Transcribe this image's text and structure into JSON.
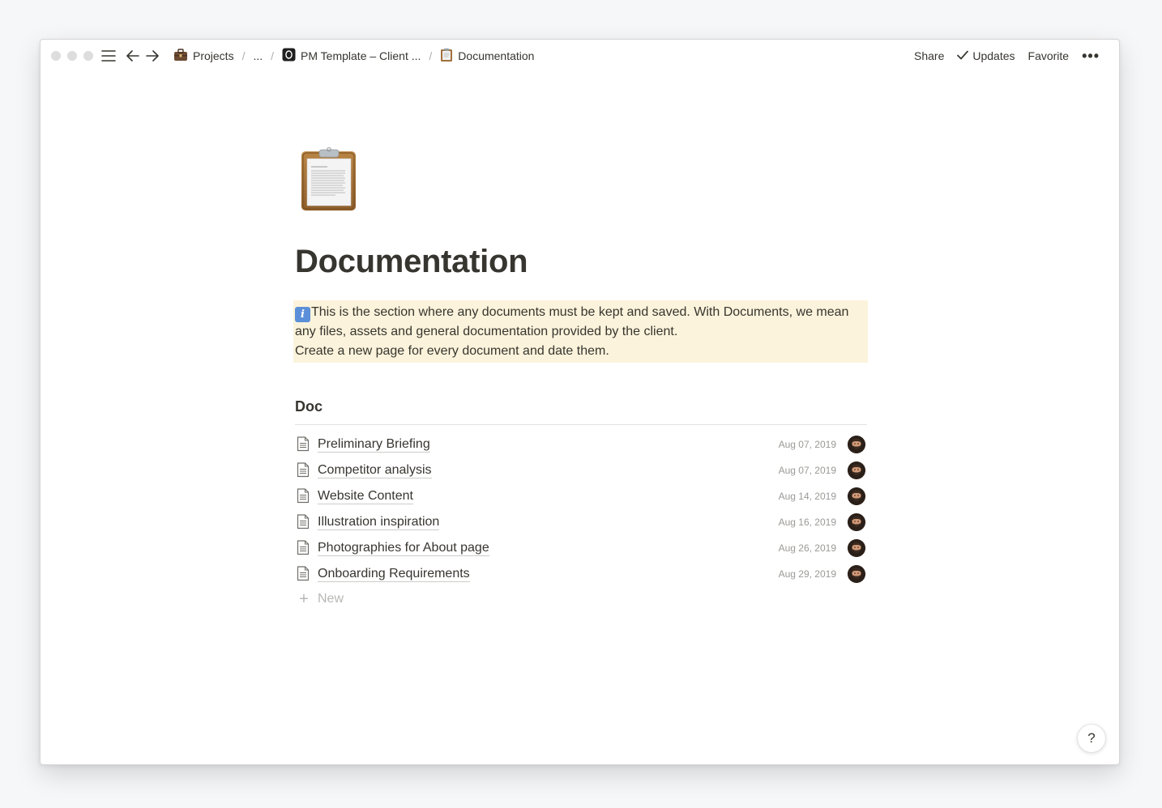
{
  "window": {
    "breadcrumbs": [
      {
        "label": "Projects",
        "icon": "briefcase-icon"
      },
      {
        "label": "..."
      },
      {
        "label": "PM Template – Client ...",
        "icon": "notion-logo-icon"
      },
      {
        "label": "Documentation",
        "icon": "clipboard-icon"
      }
    ],
    "separator": "/",
    "actions": {
      "share": "Share",
      "updates": "Updates",
      "favorite": "Favorite",
      "more": "•••"
    }
  },
  "page": {
    "icon": "clipboard-icon",
    "title": "Documentation",
    "callout": {
      "icon": "info-icon",
      "icon_glyph": "i",
      "line1": "This is the section where any documents must be kept and saved. With Documents, we mean any files, assets and general documentation provided by the client.",
      "line2": "Create a new page for every document and date them."
    },
    "database": {
      "title": "Doc",
      "rows": [
        {
          "name": "Preliminary Briefing",
          "date": "Aug 07, 2019"
        },
        {
          "name": "Competitor analysis",
          "date": "Aug 07, 2019"
        },
        {
          "name": "Website Content",
          "date": "Aug 14, 2019"
        },
        {
          "name": "Illustration inspiration",
          "date": "Aug 16, 2019"
        },
        {
          "name": "Photographies for About page",
          "date": "Aug 26, 2019"
        },
        {
          "name": "Onboarding Requirements",
          "date": "Aug 29, 2019"
        }
      ],
      "new_label": "New"
    }
  },
  "help": {
    "label": "?"
  },
  "colors": {
    "callout_bg": "#fbf3db",
    "text": "#37352f",
    "muted": "#9b9a97"
  }
}
